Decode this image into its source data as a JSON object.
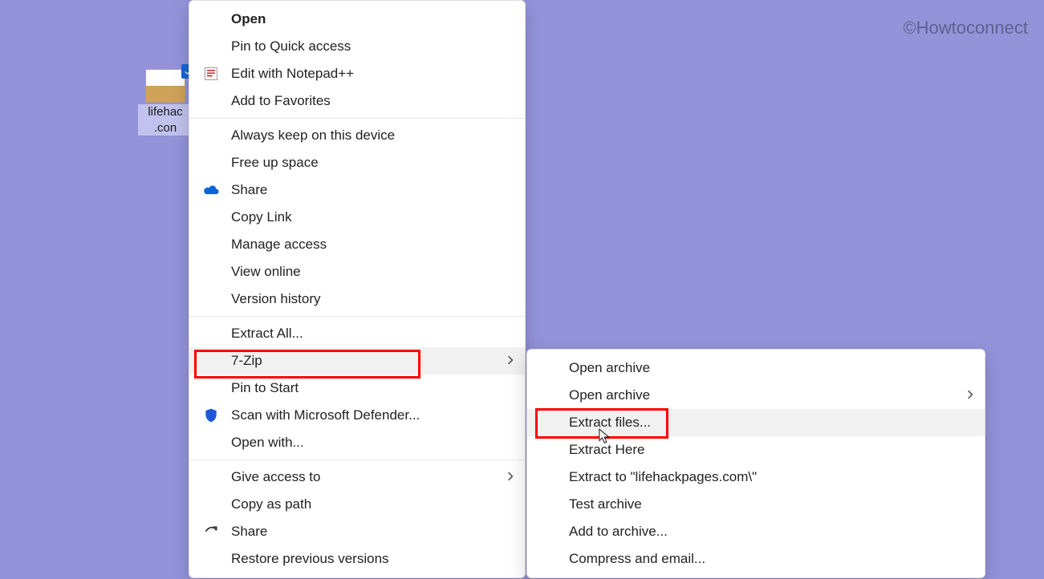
{
  "watermark": "©Howtoconnect",
  "desktop_file": {
    "line1": "lifehac",
    "line2": ".con"
  },
  "main_menu": {
    "open": "Open",
    "pin_quick": "Pin to Quick access",
    "edit_notepad": "Edit with Notepad++",
    "add_favorites": "Add to Favorites",
    "always_keep": "Always keep on this device",
    "free_up": "Free up space",
    "share_cloud": "Share",
    "copy_link": "Copy Link",
    "manage_access": "Manage access",
    "view_online": "View online",
    "version_history": "Version history",
    "extract_all": "Extract All...",
    "seven_zip": "7-Zip",
    "pin_start": "Pin to Start",
    "scan_defender": "Scan with Microsoft Defender...",
    "open_with": "Open with...",
    "give_access": "Give access to",
    "copy_path": "Copy as path",
    "share": "Share",
    "restore_versions": "Restore previous versions"
  },
  "sub_menu": {
    "open_archive": "Open archive",
    "open_archive_sub": "Open archive",
    "extract_files": "Extract files...",
    "extract_here": "Extract Here",
    "extract_to": "Extract to \"lifehackpages.com\\\"",
    "test_archive": "Test archive",
    "add_to_archive": "Add to archive...",
    "compress_email": "Compress and email..."
  }
}
